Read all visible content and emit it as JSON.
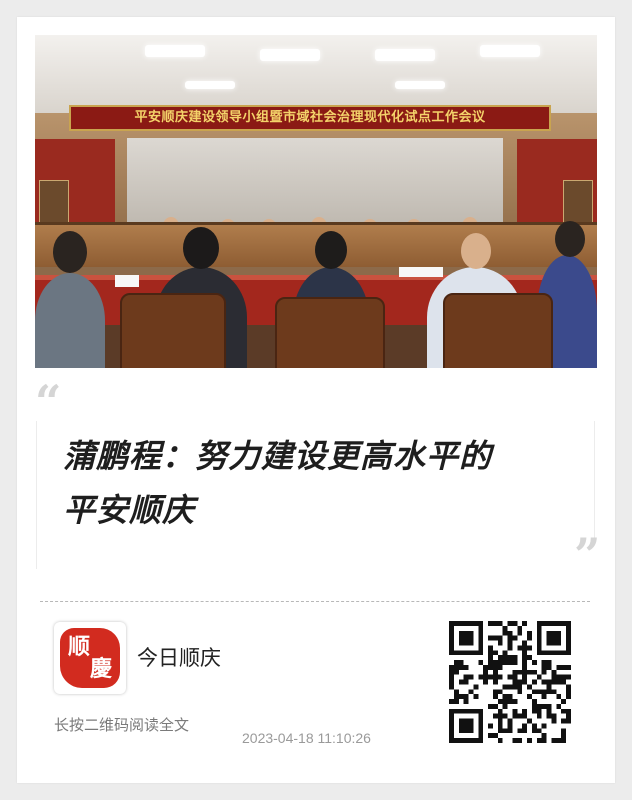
{
  "photo": {
    "banner_text": "平安顺庆建设领导小组暨市域社会治理现代化试点工作会议"
  },
  "article": {
    "quote_open": "“",
    "quote_close": "”",
    "title_line1": "蒲鹏程：努力建设更高水平的",
    "title_line2": "平安顺庆"
  },
  "footer": {
    "logo_char1": "顺",
    "logo_char2": "慶",
    "source_name": "今日顺庆",
    "hint": "长按二维码阅读全文",
    "timestamp": "2023-04-18 11:10:26"
  },
  "colors": {
    "banner_bg": "#8b1a14",
    "banner_text": "#f4d36a",
    "logo_red": "#d22b1f"
  }
}
